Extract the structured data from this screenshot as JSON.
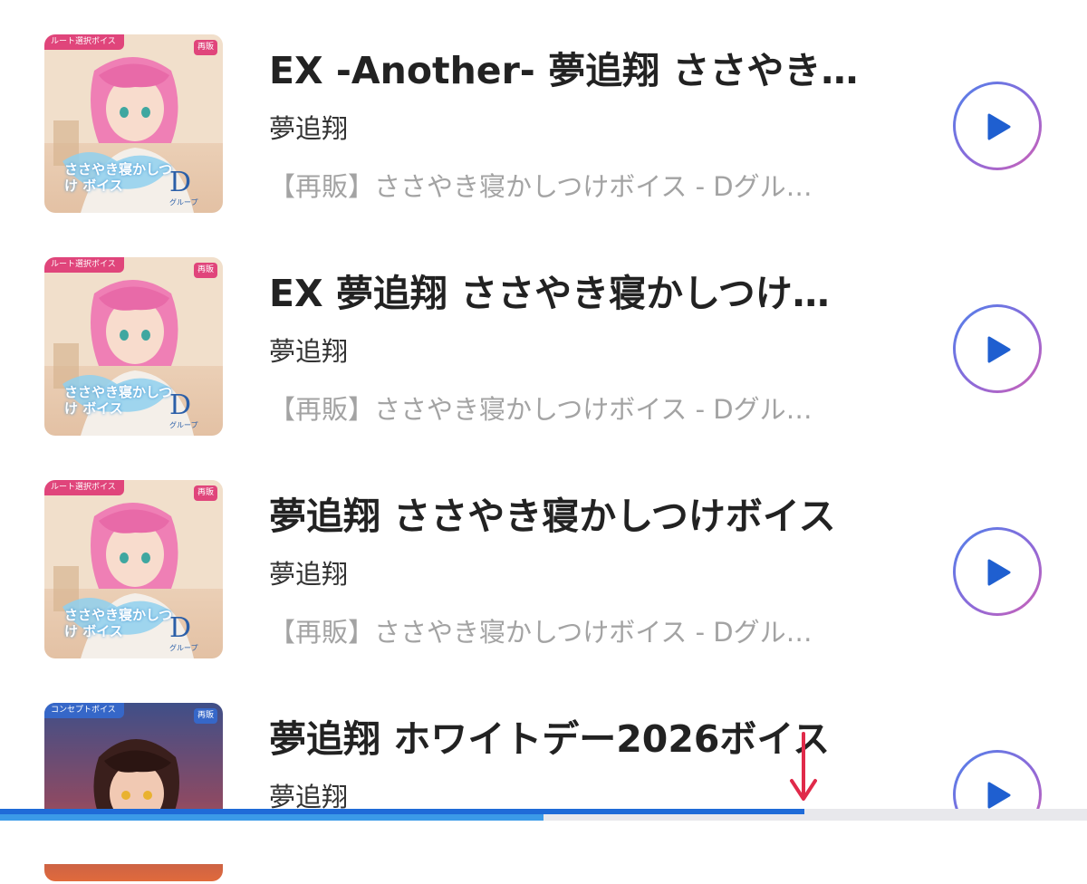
{
  "tracks": [
    {
      "title": "EX -Another- 夢追翔 ささやき…",
      "artist": "夢追翔",
      "description": "【再販】ささやき寝かしつけボイス - Dグル…",
      "thumb_tag": "ルート選択ボイス",
      "thumb_badge": "再販",
      "thumb_logo": "ささやき寝かしつけ ボイス",
      "thumb_group": "D",
      "thumb_group_sub": "グループ",
      "play_icon": "play-icon"
    },
    {
      "title": "EX 夢追翔 ささやき寝かしつけ…",
      "artist": "夢追翔",
      "description": "【再販】ささやき寝かしつけボイス - Dグル…",
      "thumb_tag": "ルート選択ボイス",
      "thumb_badge": "再販",
      "thumb_logo": "ささやき寝かしつけ ボイス",
      "thumb_group": "D",
      "thumb_group_sub": "グループ",
      "play_icon": "play-icon"
    },
    {
      "title": "夢追翔 ささやき寝かしつけボイス",
      "artist": "夢追翔",
      "description": "【再販】ささやき寝かしつけボイス - Dグル…",
      "thumb_tag": "ルート選択ボイス",
      "thumb_badge": "再販",
      "thumb_logo": "ささやき寝かしつけ ボイス",
      "thumb_group": "D",
      "thumb_group_sub": "グループ",
      "play_icon": "play-icon"
    },
    {
      "title": "夢追翔 ホワイトデー2026ボイス",
      "artist": "夢追翔",
      "thumb_tag": "コンセプトボイス",
      "thumb_badge": "再販",
      "play_icon": "play-icon"
    }
  ],
  "progress": {
    "played_fraction": 0.74,
    "buffered_fraction": 0.5
  },
  "colors": {
    "accent": "#1f6bd8",
    "buffer": "#3b9ae8",
    "arrow": "#e02a4a",
    "tag_pink": "#e0457b",
    "tag_blue": "#3667c8"
  }
}
